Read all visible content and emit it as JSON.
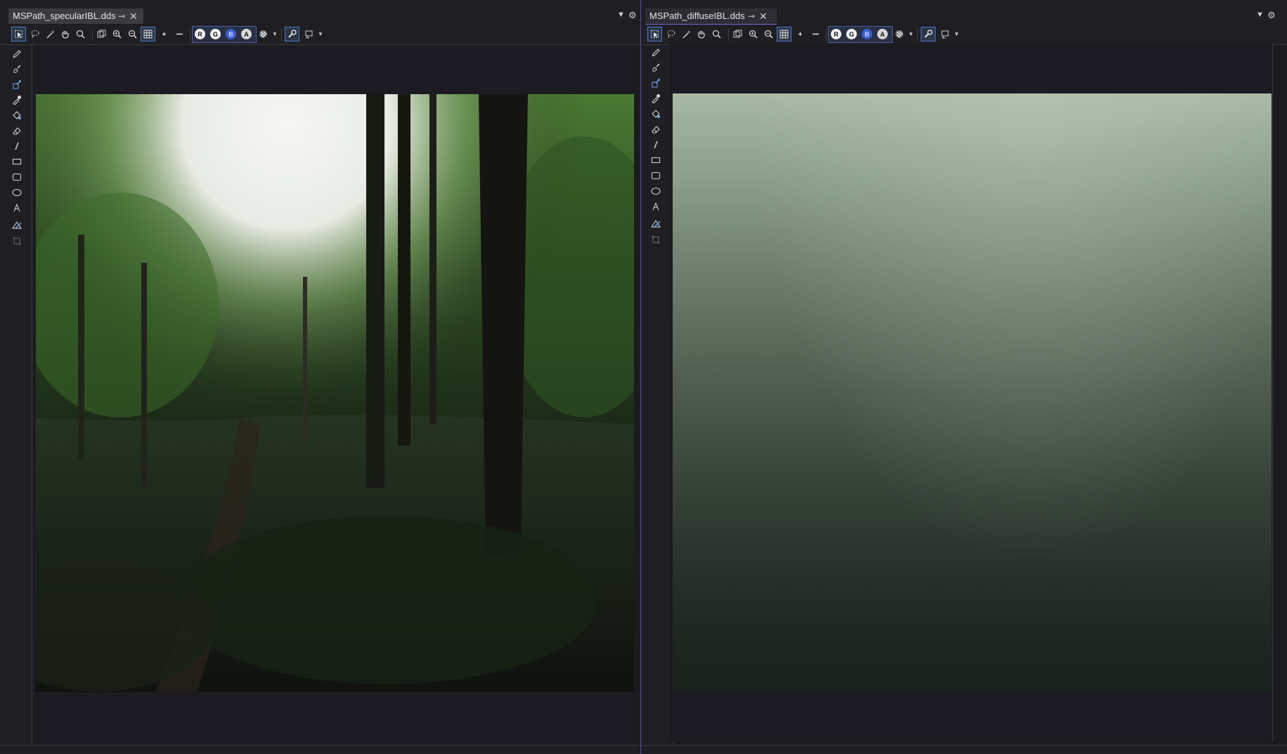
{
  "left_document": {
    "tab_title": "MSPath_specularIBL.dds"
  },
  "right_document": {
    "tab_title": "MSPath_diffuseIBL.dds"
  },
  "channels": [
    "R",
    "G",
    "B",
    "A"
  ],
  "icons": {
    "toolbar": [
      "select-icon",
      "lasso-icon",
      "magic-wand-icon",
      "hand-icon",
      "zoom-icon",
      "fit-icon",
      "zoom-in-icon",
      "zoom-out-icon",
      "grid-icon",
      "plus-icon",
      "minus-icon",
      "checkerboard-icon",
      "wrench-icon",
      "stamp-icon"
    ],
    "tools": [
      "pencil-icon",
      "brush-icon",
      "fill-icon",
      "eyedropper-icon",
      "paint-bucket-icon",
      "eraser-icon",
      "line-icon",
      "rectangle-icon",
      "rounded-rectangle-icon",
      "ellipse-icon",
      "text-icon",
      "gradient-icon",
      "crop-icon"
    ]
  },
  "colors": {
    "accent": "#7a66d8",
    "selection": "#4a78c2",
    "panel": "#1b1b1f"
  }
}
